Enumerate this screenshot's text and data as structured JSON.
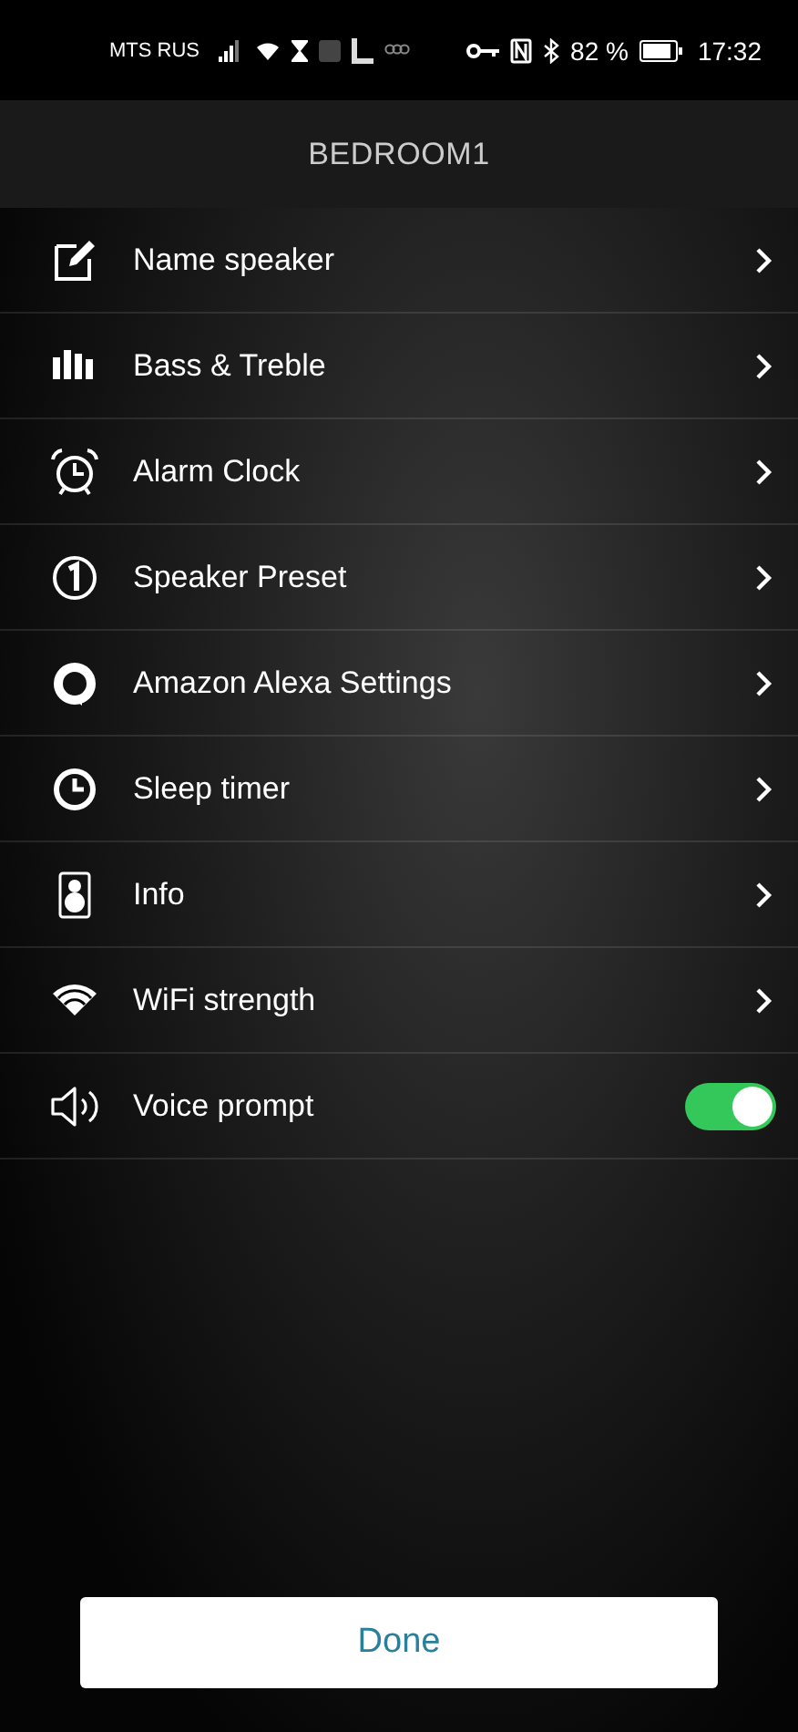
{
  "status_bar": {
    "carrier": "MTS RUS",
    "battery": "82 %",
    "time": "17:32"
  },
  "header": {
    "title": "BEDROOM1"
  },
  "items": [
    {
      "kind": "link",
      "label": "Name speaker"
    },
    {
      "kind": "link",
      "label": "Bass & Treble"
    },
    {
      "kind": "link",
      "label": "Alarm Clock"
    },
    {
      "kind": "link",
      "label": "Speaker Preset"
    },
    {
      "kind": "link",
      "label": "Amazon Alexa Settings"
    },
    {
      "kind": "link",
      "label": "Sleep timer"
    },
    {
      "kind": "link",
      "label": "Info"
    },
    {
      "kind": "link",
      "label": "WiFi strength"
    },
    {
      "kind": "toggle",
      "label": "Voice prompt",
      "on": true
    }
  ],
  "done_button": {
    "label": "Done"
  }
}
